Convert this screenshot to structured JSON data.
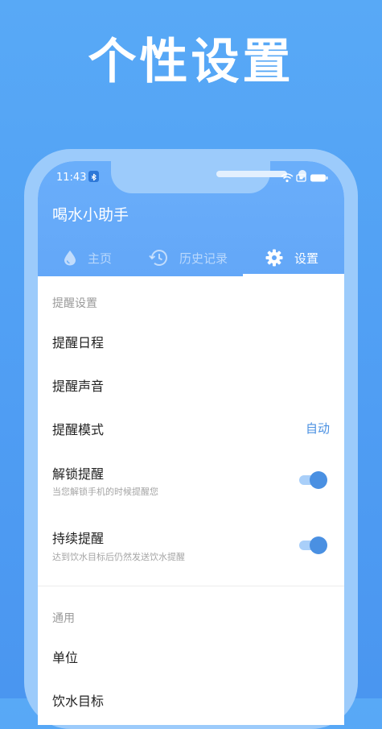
{
  "headline": "个性设置",
  "status_bar": {
    "time": "11:43"
  },
  "app": {
    "title": "喝水小助手"
  },
  "tabs": [
    {
      "label": "主页",
      "icon": "water-drop-icon",
      "active": false
    },
    {
      "label": "历史记录",
      "icon": "history-icon",
      "active": false
    },
    {
      "label": "设置",
      "icon": "gear-icon",
      "active": true
    }
  ],
  "sections": {
    "reminder": {
      "header": "提醒设置",
      "schedule": {
        "title": "提醒日程"
      },
      "sound": {
        "title": "提醒声音"
      },
      "mode": {
        "title": "提醒模式",
        "value": "自动"
      },
      "unlock": {
        "title": "解锁提醒",
        "subtitle": "当您解锁手机的时候提醒您",
        "enabled": true
      },
      "continuous": {
        "title": "持续提醒",
        "subtitle": "达到饮水目标后仍然发送饮水提醒",
        "enabled": true
      }
    },
    "general": {
      "header": "通用",
      "unit": {
        "title": "单位"
      },
      "goal": {
        "title": "饮水目标"
      }
    }
  },
  "colors": {
    "accent": "#4a90e2",
    "app_bar": "#63a7f8",
    "background": "#4f9df3"
  }
}
